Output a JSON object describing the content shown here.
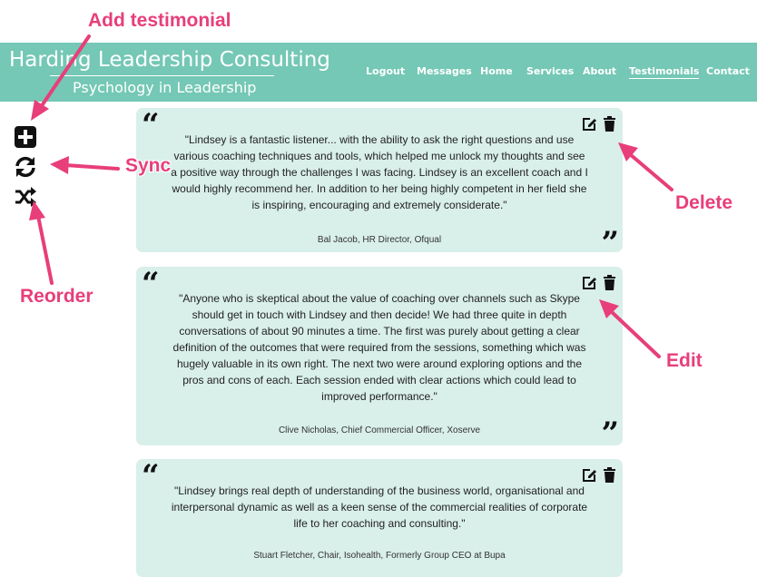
{
  "header": {
    "title": "Harding Leadership Consulting",
    "subtitle": "Psychology in Leadership",
    "bg_color": "#74c8b5"
  },
  "nav": [
    {
      "label": "Logout"
    },
    {
      "label": "Messages"
    },
    {
      "label": "Home"
    },
    {
      "label": "Services"
    },
    {
      "label": "About"
    },
    {
      "label": "Testimonials",
      "active": true
    },
    {
      "label": "Contact"
    }
  ],
  "tools": [
    {
      "icon": "plus-square-icon"
    },
    {
      "icon": "sync-icon"
    },
    {
      "icon": "shuffle-icon"
    }
  ],
  "testimonials": [
    {
      "text": "\"Lindsey is a fantastic listener... with the ability to ask the right questions and use various coaching techniques and tools, which helped me unlock my thoughts and see a positive way through the challenges I was facing. Lindsey is an excellent coach and I would highly recommend her. In addition to her being highly competent in her field she is inspiring, encouraging and extremely considerate.\"",
      "author": "Bal Jacob, HR Director, Ofqual"
    },
    {
      "text": "\"Anyone who is skeptical about the value of coaching over channels such as Skype should get in touch with Lindsey and then decide! We had three quite in depth conversations of about 90 minutes a time. The first was purely about getting a clear definition of the outcomes that were required from the sessions, something which was hugely valuable in its own right. The next two were around exploring options and the pros and cons of each. Each session ended with clear actions which could lead to improved performance.\"",
      "author": "Clive Nicholas, Chief Commercial Officer, Xoserve"
    },
    {
      "text": "\"Lindsey brings real depth of understanding of the business world, organisational and interpersonal dynamic as well as a keen sense of the commercial realities of corporate life to her coaching and consulting.\"",
      "author": "Stuart Fletcher, Chair, Isohealth, Formerly Group CEO at Bupa"
    }
  ],
  "glyphs": {
    "open_quote": "“",
    "close_quote": "”"
  },
  "annotations": {
    "add": "Add testimonial",
    "sync": "Sync",
    "reorder": "Reorder",
    "delete": "Delete",
    "edit": "Edit",
    "color": "#e83e7a"
  },
  "colors": {
    "card_bg": "#d9efe9",
    "header_bg": "#74c8b5"
  }
}
